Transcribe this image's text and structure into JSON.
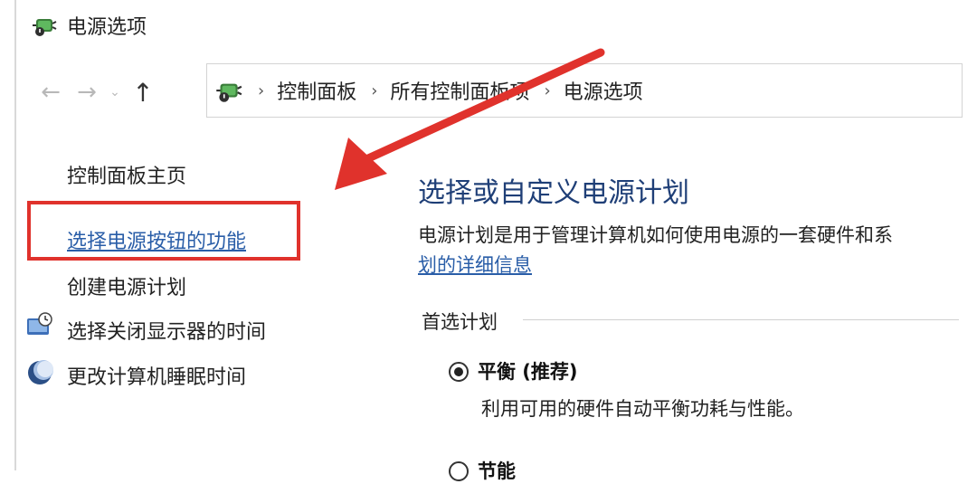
{
  "window": {
    "title": "电源选项",
    "icon": "power-options-icon"
  },
  "nav": {
    "back_label": "←",
    "forward_label": "→",
    "recent_label": "⌄",
    "up_label": "↑"
  },
  "address": {
    "icon": "power-options-icon",
    "separator": "›",
    "crumbs": [
      "控制面板",
      "所有控制面板项",
      "电源选项"
    ]
  },
  "sidebar": {
    "home": "控制面板主页",
    "items": [
      {
        "label": "选择电源按钮的功能",
        "link": true,
        "highlighted": true
      },
      {
        "label": "创建电源计划",
        "link": false
      },
      {
        "label": "选择关闭显示器的时间",
        "icon": "monitor-clock-icon"
      },
      {
        "label": "更改计算机睡眠时间",
        "icon": "moon-icon"
      }
    ]
  },
  "main": {
    "heading": "选择或自定义电源计划",
    "description": "电源计划是用于管理计算机如何使用电源的一套硬件和系",
    "details_link": "划的详细信息",
    "section_title": "首选计划",
    "plans": [
      {
        "name": "平衡 (推荐)",
        "description": "利用可用的硬件自动平衡功耗与性能。",
        "selected": true
      },
      {
        "name": "节能",
        "selected": false
      }
    ]
  },
  "annotation": {
    "box_color": "#e0322c",
    "arrow_color": "#e0322c"
  },
  "colors": {
    "heading": "#1f3f77",
    "link": "#2a5ea8"
  }
}
